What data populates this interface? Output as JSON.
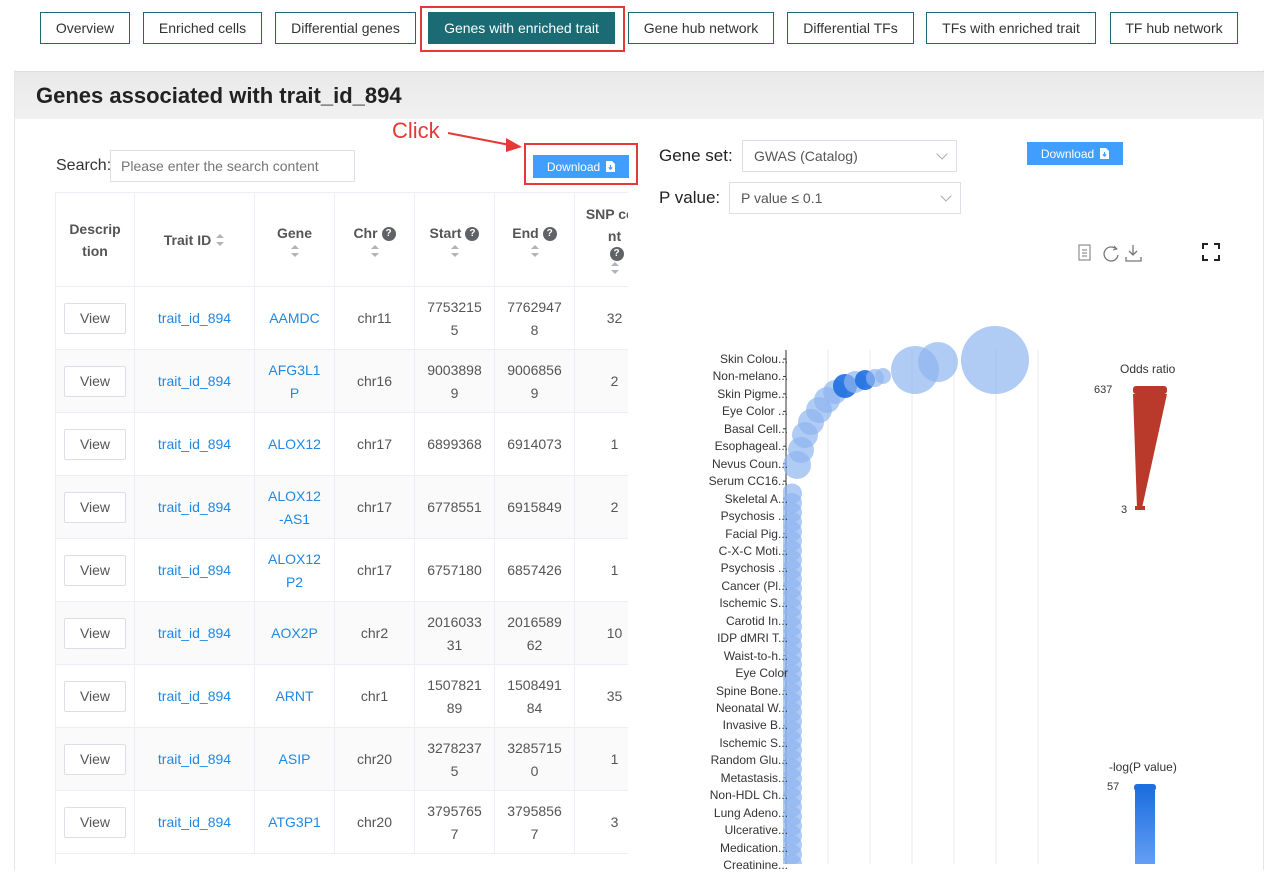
{
  "nav": {
    "tabs": [
      "Overview",
      "Enriched cells",
      "Differential genes",
      "Genes with enriched trait",
      "Gene hub network",
      "Differential TFs",
      "TFs with enriched trait",
      "TF hub network"
    ],
    "active_tab": "Genes with enriched trait"
  },
  "panel": {
    "title": "Genes associated with trait_id_894"
  },
  "annotation": {
    "click_label": "Click",
    "color": "#e53935"
  },
  "left": {
    "search_label": "Search:",
    "search_placeholder": "Please enter the search content",
    "download_label": "Download",
    "columns": [
      "Description",
      "Trait ID",
      "Gene",
      "Chr",
      "Start",
      "End",
      "SNP count"
    ],
    "rows": [
      {
        "btn": "View",
        "trait": "trait_id_894",
        "gene": "AAMDC",
        "chr": "chr11",
        "start": "77532155",
        "end": "77629478",
        "snp": "32"
      },
      {
        "btn": "View",
        "trait": "trait_id_894",
        "gene": "AFG3L1P",
        "chr": "chr16",
        "start": "90038989",
        "end": "90068569",
        "snp": "2"
      },
      {
        "btn": "View",
        "trait": "trait_id_894",
        "gene": "ALOX12",
        "chr": "chr17",
        "start": "6899368",
        "end": "6914073",
        "snp": "1"
      },
      {
        "btn": "View",
        "trait": "trait_id_894",
        "gene": "ALOX12-AS1",
        "chr": "chr17",
        "start": "6778551",
        "end": "6915849",
        "snp": "2"
      },
      {
        "btn": "View",
        "trait": "trait_id_894",
        "gene": "ALOX12P2",
        "chr": "chr17",
        "start": "6757180",
        "end": "6857426",
        "snp": "1"
      },
      {
        "btn": "View",
        "trait": "trait_id_894",
        "gene": "AOX2P",
        "chr": "chr2",
        "start": "201603331",
        "end": "201658962",
        "snp": "10"
      },
      {
        "btn": "View",
        "trait": "trait_id_894",
        "gene": "ARNT",
        "chr": "chr1",
        "start": "150782189",
        "end": "150849184",
        "snp": "35"
      },
      {
        "btn": "View",
        "trait": "trait_id_894",
        "gene": "ASIP",
        "chr": "chr20",
        "start": "32782375",
        "end": "32857150",
        "snp": "1"
      },
      {
        "btn": "View",
        "trait": "trait_id_894",
        "gene": "ATG3P1",
        "chr": "chr20",
        "start": "37957657",
        "end": "37958567",
        "snp": "3"
      }
    ]
  },
  "right": {
    "gene_set_label": "Gene set:",
    "gene_set_value": "GWAS (Catalog)",
    "pvalue_label": "P value:",
    "pvalue_value": "P value ≤ 0.1",
    "download_label": "Download",
    "tool_icons": [
      "data-view-icon",
      "refresh-icon",
      "save-image-icon",
      "fullscreen-icon"
    ],
    "legend_odds": {
      "title": "Odds ratio",
      "max": "637",
      "min": "3",
      "color": "#b93a2a"
    },
    "legend_p": {
      "title": "-log(P value)",
      "max": "57",
      "color": "#1e6fe0"
    },
    "y_labels": [
      "Skin Colou...",
      "Non-melano...",
      "Skin Pigme...",
      "Eye Color ...",
      "Basal Cell...",
      "Esophageal...",
      "Nevus Coun...",
      "Serum CC16...",
      "Skeletal A...",
      "Psychosis ...",
      "Facial Pig...",
      "C-X-C Moti...",
      "Psychosis ...",
      "Cancer (Pl...",
      "Ischemic S...",
      "Carotid In...",
      "IDP dMRI T...",
      "Waist-to-h...",
      "Eye Color",
      "Spine Bone...",
      "Neonatal W...",
      "Invasive B...",
      "Ischemic S...",
      "Random Glu...",
      "Metastasis...",
      "Non-HDL Ch...",
      "Lung Adeno...",
      "Ulcerative...",
      "Medication...",
      "Creatinine..."
    ]
  }
}
